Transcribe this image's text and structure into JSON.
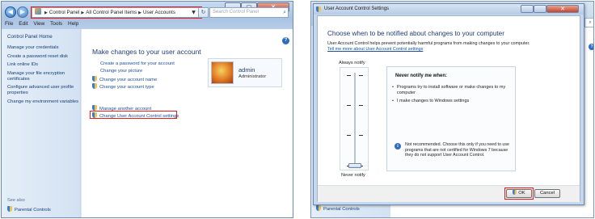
{
  "left_window": {
    "breadcrumb": [
      "Control Panel",
      "All Control Panel Items",
      "User Accounts"
    ],
    "search_placeholder": "Search Control Panel",
    "menu": [
      "File",
      "Edit",
      "View",
      "Tools",
      "Help"
    ],
    "sidebar": {
      "home": "Control Panel Home",
      "links": [
        "Manage your credentials",
        "Create a password reset disk",
        "Link online IDs",
        "Manage your file encryption certificates",
        "Configure advanced user profile properties",
        "Change my environment variables"
      ],
      "see_also": "See also",
      "parental_controls": "Parental Controls"
    },
    "main": {
      "title": "Make changes to your user account",
      "tasks": [
        "Create a password for your account",
        "Change your picture",
        "Change your account name",
        "Change your account type"
      ],
      "tasks2": [
        "Manage another account",
        "Change User Account Control settings"
      ],
      "user": {
        "name": "admin",
        "role": "Administrator"
      }
    }
  },
  "right_window": {
    "title": "User Account Control Settings",
    "heading": "Choose when to be notified about changes to your computer",
    "description": "User Account Control helps prevent potentially harmful programs from making changes to your computer.",
    "link": "Tell me more about User Account Control settings",
    "slider": {
      "top_label": "Always notify",
      "bottom_label": "Never notify",
      "level": 0,
      "levels": 4
    },
    "panel": {
      "title": "Never notify me when:",
      "bullets": [
        "Programs try to install software or make changes to my computer",
        "I make changes to Windows settings"
      ],
      "note": "Not recommended. Choose this only if you need to use programs that are not certified for Windows 7 because they do not support User Account Control."
    },
    "buttons": {
      "ok": "OK",
      "cancel": "Cancel"
    },
    "background_parental_controls": "Parental Controls"
  },
  "colors": {
    "annotation_red": "#e21c1c",
    "link_blue": "#1a4e9c",
    "heading_blue": "#1e3d76"
  }
}
